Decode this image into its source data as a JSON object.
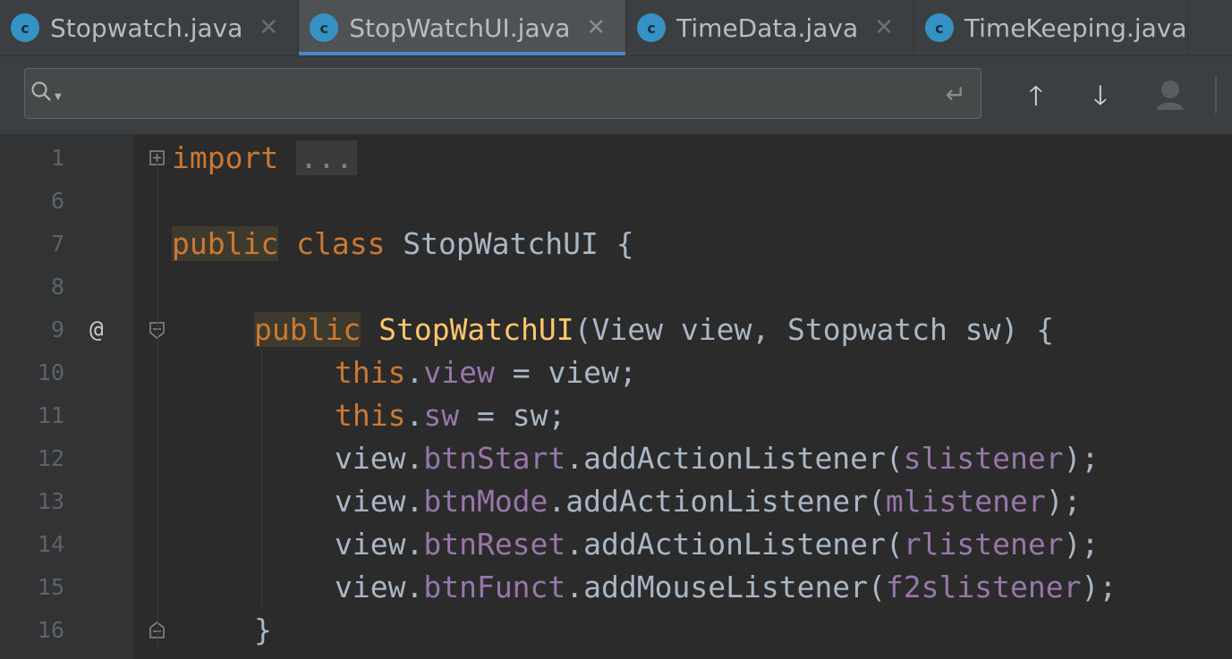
{
  "tabs": [
    {
      "label": "Stopwatch.java",
      "active": false
    },
    {
      "label": "StopWatchUI.java",
      "active": true
    },
    {
      "label": "TimeData.java",
      "active": false
    },
    {
      "label": "TimeKeeping.java",
      "active": false
    }
  ],
  "tab_icon_letter": "c",
  "search": {
    "value": "",
    "placeholder": ""
  },
  "editor": {
    "line_numbers": [
      "1",
      "6",
      "7",
      "8",
      "9",
      "10",
      "11",
      "12",
      "13",
      "14",
      "15",
      "16"
    ],
    "lines": [
      {
        "import_kw": "import",
        "collapsed": "..."
      },
      {},
      {
        "kw": "public",
        "rest": " class StopWatchUI {",
        "class_kw": "class",
        "class_name": " StopWatchUI {"
      },
      {},
      {
        "kw": "public",
        "name": "StopWatchUI",
        "params": "(View view, Stopwatch sw) {"
      },
      {
        "this": "this",
        "dot": ".",
        "field": "view",
        "rest": " = view;"
      },
      {
        "this": "this",
        "dot": ".",
        "field": "sw",
        "rest": " = sw;"
      },
      {
        "obj": "view.",
        "field": "btnStart",
        "call": ".addActionListener(",
        "arg": "slistener",
        "end": ");"
      },
      {
        "obj": "view.",
        "field": "btnMode",
        "call": ".addActionListener(",
        "arg": "mlistener",
        "end": ");"
      },
      {
        "obj": "view.",
        "field": "btnReset",
        "call": ".addActionListener(",
        "arg": "rlistener",
        "end": ");"
      },
      {
        "obj": "view.",
        "field": "btnFunct",
        "call": ".addMouseListener(",
        "arg": "f2slistener",
        "end": ");"
      },
      {
        "brace": "}"
      }
    ],
    "gutter_mark": "@"
  },
  "colors": {
    "keyword": "#cc7832",
    "field": "#9876aa",
    "method": "#ffc66d",
    "text": "#a9b7c6",
    "accent": "#4a88c7"
  }
}
